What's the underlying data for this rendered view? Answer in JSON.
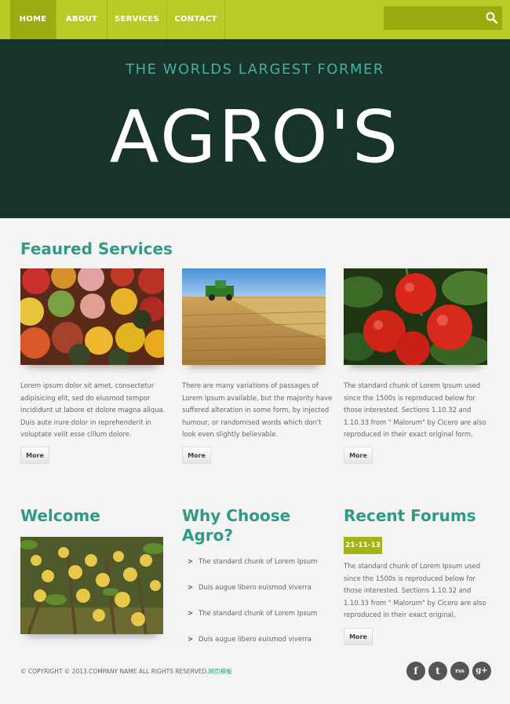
{
  "nav": {
    "items": [
      {
        "label": "HOME"
      },
      {
        "label": "ABOUT"
      },
      {
        "label": "SERVICES"
      },
      {
        "label": "CONTACT"
      }
    ],
    "search_placeholder": ""
  },
  "hero": {
    "subtitle": "THE WORLDS LARGEST FORMER",
    "title": "AGRO'S"
  },
  "featured": {
    "heading": "Feaured Services",
    "cards": [
      {
        "text": "Lorem ipsum dolor sit amet, consectetur adipisicing elit, sed do eiusmod tempor incididunt ut labore et dolore magna aliqua. Duis aute irure dolor in reprehenderit in voluptate velit esse cillum dolore.",
        "button": "More",
        "image": "vegetables-photo"
      },
      {
        "text": "There are many variations of passages of Lorem Ipsum available, but the majority have suffered alteration in some form, by injected humour, or randomised words which don't look even slightly believable.",
        "button": "More",
        "image": "wheat-field-photo"
      },
      {
        "text": "The standard chunk of Lorem Ipsum used since the 1500s is reproduced below for those interested. Sections 1.10.32 and 1.10.33 from \" Malorum\" by Cicero are also reproduced in their exact original form,",
        "button": "More",
        "image": "tomatoes-photo"
      }
    ]
  },
  "welcome": {
    "heading": "Welcome",
    "image": "fruit-tree-photo"
  },
  "why": {
    "heading_line1": "Why Choose",
    "heading_line2": "Agro?",
    "items": [
      "The standard chunk of Lorem Ipsum",
      "Duis augue libero euismod viverra",
      "The standard chunk of Lorem Ipsum",
      "Duis augue libero euismod viverra"
    ]
  },
  "forums": {
    "heading": "Recent Forums",
    "date": "21-11-13",
    "text": "The standard chunk of Lorem Ipsum used since the 1500s is reproduced below for those interested. Sections 1.10.32 and 1.10.33 from \" Malorum\" by Cicero are also reproduced in their exact original,",
    "button": "More"
  },
  "footer": {
    "copyright": "© COPYRIGHT © 2013.COMPANY NAME ALL RIGHTS RESERVED.",
    "link": "网页模板",
    "social": [
      {
        "glyph": "f",
        "icon": "facebook-icon"
      },
      {
        "glyph": "t",
        "icon": "twitter-icon"
      },
      {
        "glyph": "rss",
        "icon": "rss-icon"
      },
      {
        "glyph": "g+",
        "icon": "google-plus-icon"
      }
    ]
  },
  "colors": {
    "accent_green": "#b9c926",
    "hero_bg": "#18332c",
    "heading_teal": "#2f9a86"
  }
}
